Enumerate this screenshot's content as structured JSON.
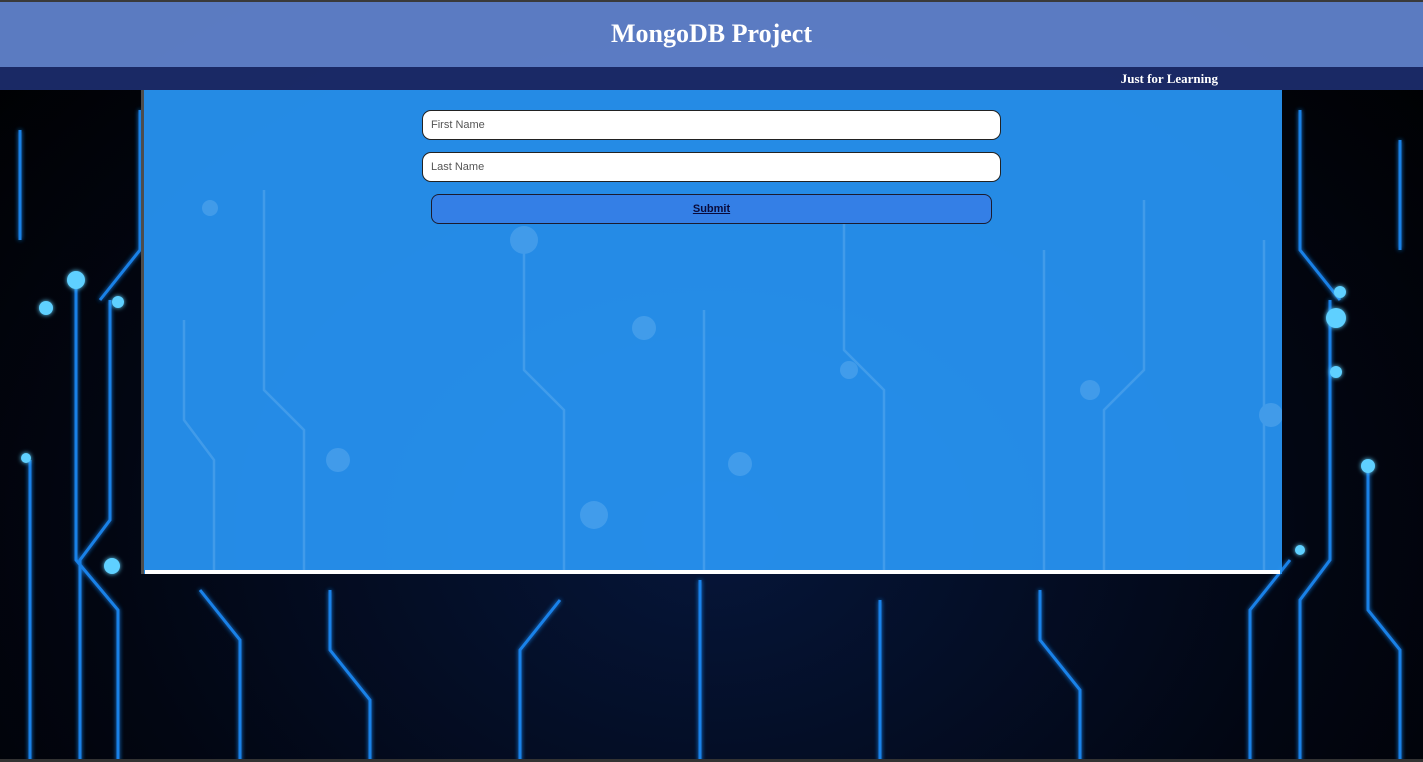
{
  "header": {
    "title": "MongoDB Project"
  },
  "subbar": {
    "tagline": "Just for Learning"
  },
  "form": {
    "first_name": {
      "value": "",
      "placeholder": "First Name"
    },
    "last_name": {
      "value": "",
      "placeholder": "Last Name"
    },
    "submit_label": "Submit"
  },
  "colors": {
    "header_bg": "#688cdc",
    "subbar_bg": "#1c2c6e",
    "panel_bg": "#2896f5",
    "submit_bg": "#347fe6",
    "background": "#020612"
  },
  "background_image": "circuit-board-pattern"
}
